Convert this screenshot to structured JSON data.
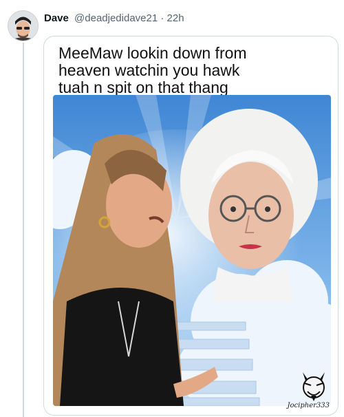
{
  "author": {
    "name": "Dave",
    "handle": "@deadjedidave21",
    "separator": "·",
    "time": "22h"
  },
  "quote": {
    "text": "MeeMaw lookin down from\nheaven watchin you hawk\ntuah n spit on that thang"
  },
  "image": {
    "watermark": "Jocipher333"
  },
  "colors": {
    "sky": "#4e95dc",
    "border": "#cfd9de",
    "text": "#0f1419",
    "muted": "#536471"
  }
}
